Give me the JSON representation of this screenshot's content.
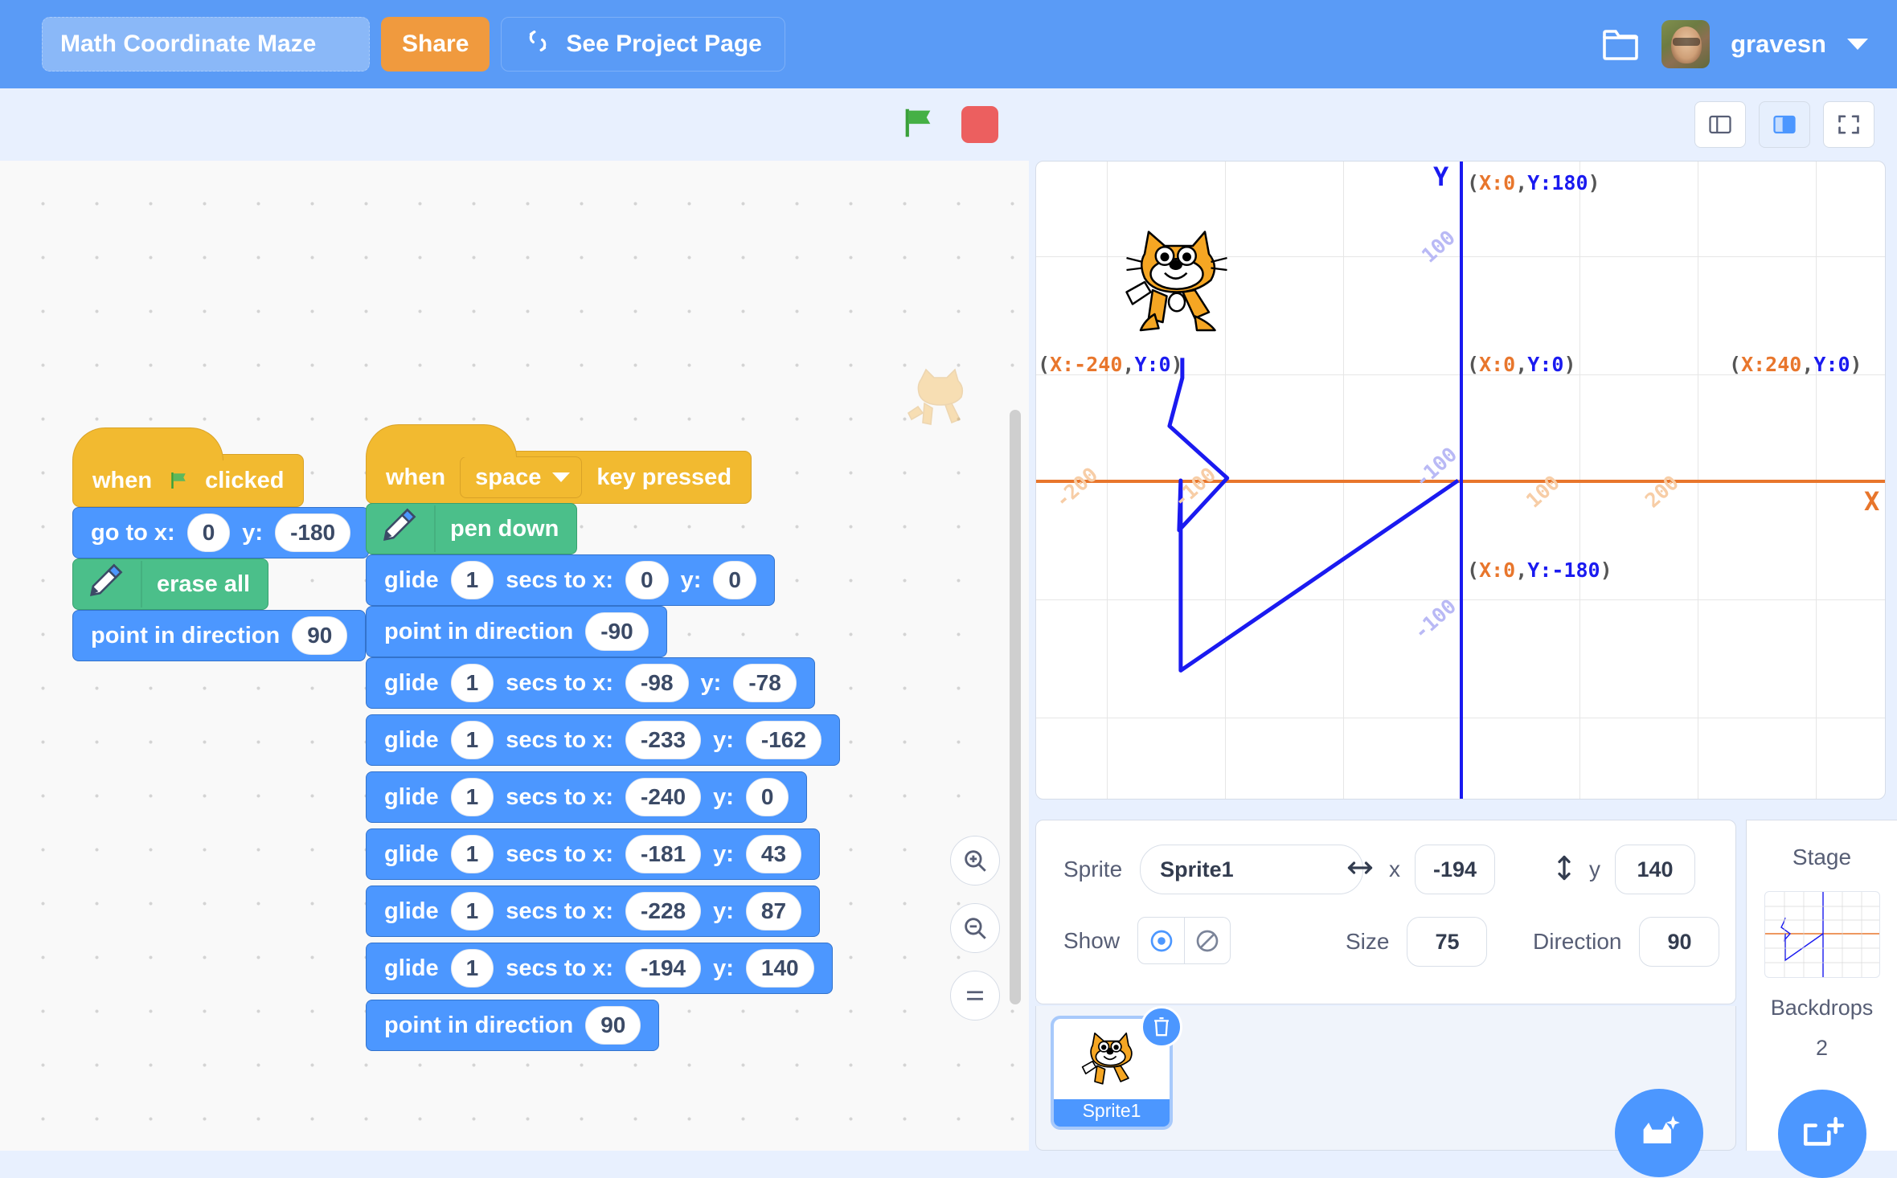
{
  "menubar": {
    "project_title": "Math Coordinate Maze",
    "share_label": "Share",
    "project_page_label": "See Project Page",
    "username": "gravesn",
    "folder_icon": "folder-icon",
    "caret_icon": "chevron-down-icon"
  },
  "toolbar": {
    "green_flag_icon": "green-flag-icon",
    "stop_icon": "stop-sign-icon",
    "small_stage_icon": "small-stage-layout-icon",
    "large_stage_icon": "large-stage-layout-icon",
    "fullscreen_icon": "fullscreen-icon"
  },
  "scripts": [
    {
      "id": "script-flag",
      "hat": {
        "prefix": "when",
        "icon": "green-flag-icon",
        "suffix": "clicked"
      },
      "blocks": [
        {
          "type": "motion",
          "label_parts": [
            "go to x:",
            "y:"
          ],
          "inputs": [
            "0",
            "-180"
          ]
        },
        {
          "type": "pen",
          "icon": "pen-icon",
          "label": "erase all"
        },
        {
          "type": "motion",
          "label_parts": [
            "point in direction"
          ],
          "inputs": [
            "90"
          ]
        }
      ]
    },
    {
      "id": "script-space",
      "hat": {
        "prefix": "when",
        "dropdown": "space",
        "suffix": "key pressed"
      },
      "blocks": [
        {
          "type": "pen",
          "icon": "pen-icon",
          "label": "pen down"
        },
        {
          "type": "glide",
          "secs": "1",
          "x": "0",
          "y": "0"
        },
        {
          "type": "motion",
          "label_parts": [
            "point in direction"
          ],
          "inputs": [
            "-90"
          ]
        },
        {
          "type": "glide",
          "secs": "1",
          "x": "-98",
          "y": "-78"
        },
        {
          "type": "glide",
          "secs": "1",
          "x": "-233",
          "y": "-162"
        },
        {
          "type": "glide",
          "secs": "1",
          "x": "-240",
          "y": "0"
        },
        {
          "type": "glide",
          "secs": "1",
          "x": "-181",
          "y": "43"
        },
        {
          "type": "glide",
          "secs": "1",
          "x": "-228",
          "y": "87"
        },
        {
          "type": "glide",
          "secs": "1",
          "x": "-194",
          "y": "140"
        },
        {
          "type": "motion",
          "label_parts": [
            "point in direction"
          ],
          "inputs": [
            "90"
          ]
        }
      ],
      "words": {
        "glide": "glide",
        "secs_to_x": "secs to x:",
        "y": "y:",
        "point_in_direction": "point in direction",
        "go_to_x": "go to x:",
        "when": "when",
        "clicked": "clicked",
        "key_pressed": "key pressed",
        "pen_down": "pen down",
        "erase_all": "erase all"
      }
    }
  ],
  "stage": {
    "labels": {
      "top_center": {
        "x": "X:0",
        "y": "Y:180"
      },
      "left_origin": {
        "x": "X:-240",
        "y": "Y:0"
      },
      "center_origin": {
        "x": "X:0",
        "y": "Y:0"
      },
      "right_origin": {
        "x": "X:240",
        "y": "Y:0"
      },
      "bottom_center": {
        "x": "X:0",
        "y": "Y:-180"
      }
    },
    "x_ticks": [
      "-200",
      "-100",
      "100",
      "200"
    ],
    "y_ticks": [
      "100",
      "-100"
    ],
    "axis_name_x": "X",
    "axis_name_y": "Y",
    "colors": {
      "x_axis": "#e8762c",
      "y_axis": "#1a1af0",
      "pen": "#1a1af0"
    }
  },
  "sprite_info": {
    "sprite_label": "Sprite",
    "sprite_name": "Sprite1",
    "x_label": "x",
    "x_value": "-194",
    "y_label": "y",
    "y_value": "140",
    "show_label": "Show",
    "show_on_icon": "eye-visible-icon",
    "show_off_icon": "eye-hidden-icon",
    "size_label": "Size",
    "size_value": "75",
    "direction_label": "Direction",
    "direction_value": "90"
  },
  "sprite_list": {
    "tiles": [
      {
        "name": "Sprite1",
        "delete_icon": "trash-icon"
      }
    ],
    "add_sprite_icon": "add-sprite-icon"
  },
  "stage_panel": {
    "title": "Stage",
    "backdrops_label": "Backdrops",
    "backdrops_count": "2",
    "add_backdrop_icon": "add-backdrop-icon"
  },
  "zoom_controls": {
    "zoom_in_icon": "zoom-in-icon",
    "zoom_out_icon": "zoom-out-icon",
    "zoom_reset_icon": "zoom-reset-icon"
  }
}
